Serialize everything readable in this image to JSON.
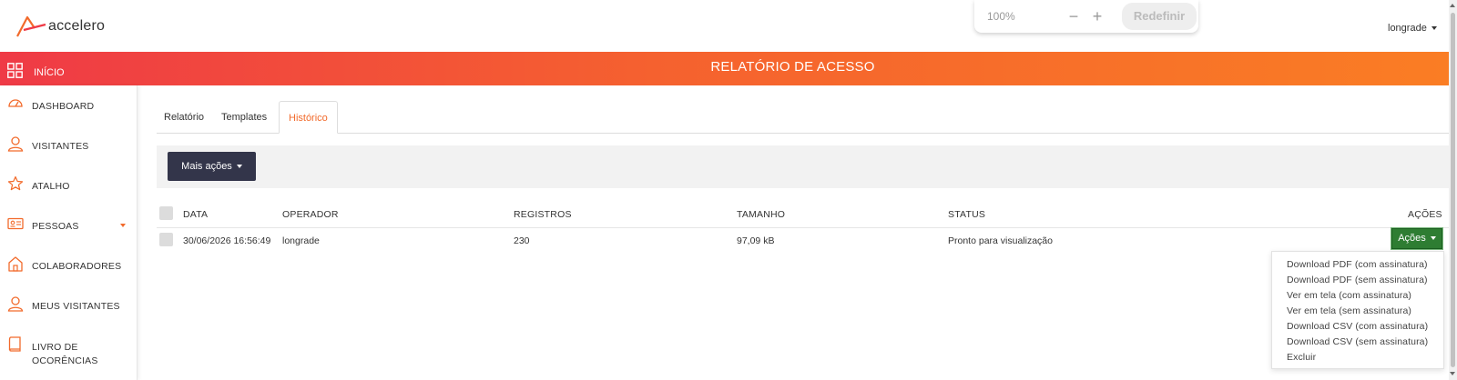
{
  "app": {
    "logo_text": "accelero",
    "user": "longrade"
  },
  "zoom": {
    "level": "100%",
    "minus": "−",
    "plus": "+",
    "reset_label": "Redefinir"
  },
  "banner": {
    "home_label": "INÍCIO",
    "title": "RELATÓRIO DE ACESSO"
  },
  "sidebar": {
    "items": [
      {
        "label": "DASHBOARD",
        "icon": "gauge-icon"
      },
      {
        "label": "VISITANTES",
        "icon": "user-icon"
      },
      {
        "label": "ATALHO",
        "icon": "star-icon"
      },
      {
        "label": "PESSOAS",
        "icon": "id-card-icon"
      },
      {
        "label": "COLABORADORES",
        "icon": "home-icon"
      },
      {
        "label": "MEUS VISITANTES",
        "icon": "user-icon"
      },
      {
        "label": "LIVRO DE OCORÊNCIAS",
        "icon": "book-icon"
      }
    ]
  },
  "tabs": [
    {
      "label": "Relatório",
      "active": false
    },
    {
      "label": "Templates",
      "active": false
    },
    {
      "label": "Histórico",
      "active": true
    }
  ],
  "toolbar": {
    "more_actions_label": "Mais ações"
  },
  "table": {
    "headers": {
      "date": "DATA",
      "operator": "OPERADOR",
      "records": "REGISTROS",
      "size": "TAMANHO",
      "status": "STATUS",
      "actions": "AÇÕES"
    },
    "rows": [
      {
        "date": "30/06/2026 16:56:49",
        "operator": "longrade",
        "records": "230",
        "size": "97,09 kB",
        "status": "Pronto para visualização",
        "action_label": "Ações"
      }
    ]
  },
  "actions_menu": {
    "items": [
      "Download PDF (com assinatura)",
      "Download PDF (sem assinatura)",
      "Ver em tela (com assinatura)",
      "Ver em tela (sem assinatura)",
      "Download CSV (com assinatura)",
      "Download CSV (sem assinatura)",
      "Excluir"
    ]
  },
  "colors": {
    "brand_orange": "#f26a2b",
    "banner_start": "#ef3a46",
    "banner_end": "#fa7d24",
    "dark_button": "#33354a",
    "action_green": "#2e7d32"
  }
}
